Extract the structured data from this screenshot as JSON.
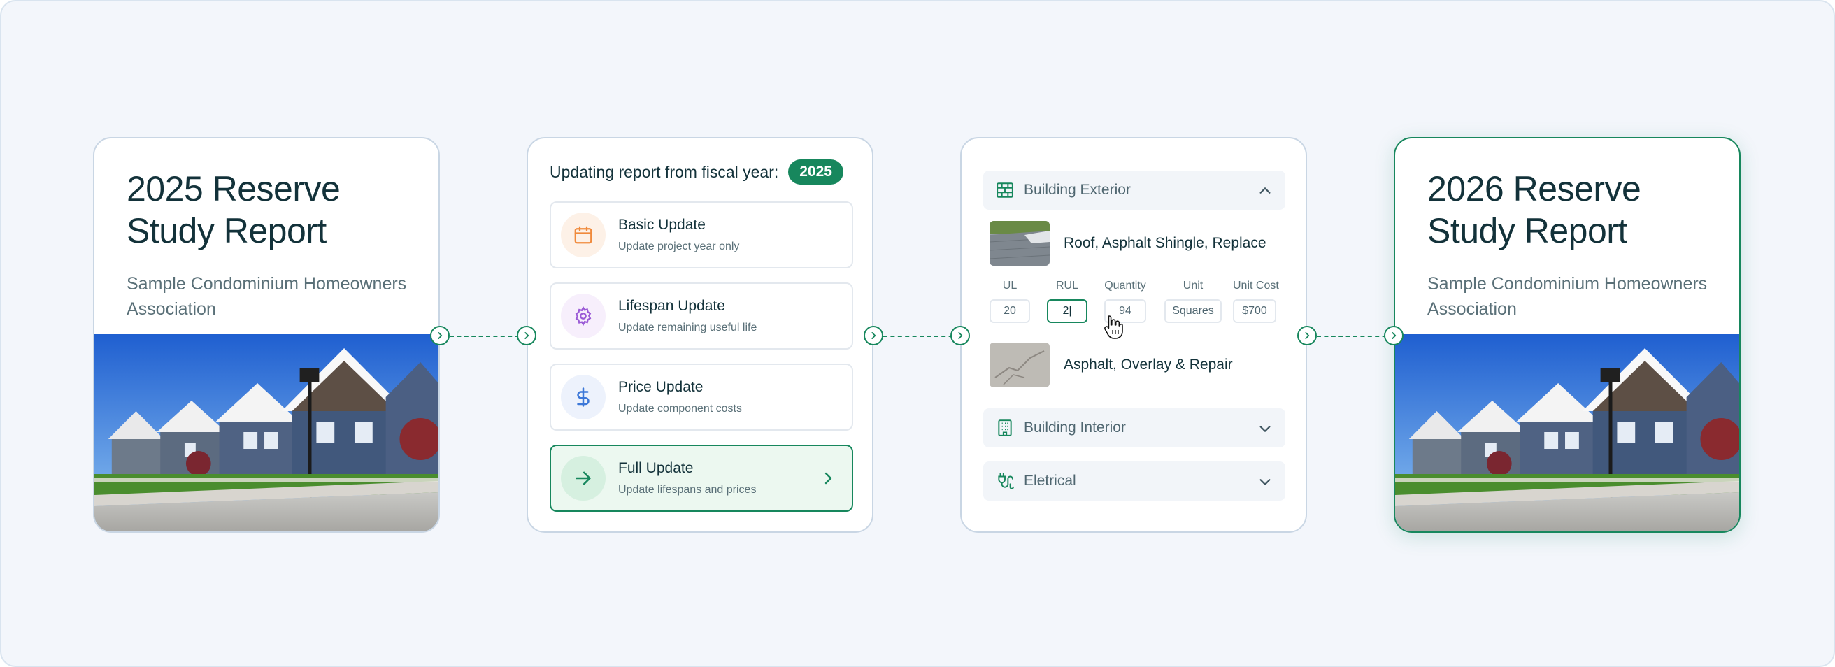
{
  "colors": {
    "accent": "#17875d",
    "text": "#13323a",
    "muted": "#5a7078"
  },
  "report_before": {
    "title": "2025 Reserve Study Report",
    "subtitle": "Sample Condominium Homeowners Association",
    "image_icon": "townhouse-photo"
  },
  "fiscal": {
    "label": "Updating report from fiscal year:",
    "year": "2025",
    "options": [
      {
        "title": "Basic Update",
        "desc": "Update project year only",
        "icon": "calendar-icon"
      },
      {
        "title": "Lifespan Update",
        "desc": "Update remaining useful life",
        "icon": "gear-icon"
      },
      {
        "title": "Price Update",
        "desc": "Update component costs",
        "icon": "dollar-icon"
      },
      {
        "title": "Full Update",
        "desc": "Update lifespans and prices",
        "icon": "arrow-right-icon",
        "selected": true
      }
    ]
  },
  "components": {
    "sections": [
      {
        "label": "Building Exterior",
        "icon": "brick-wall-icon",
        "expanded": true
      },
      {
        "label": "Building Interior",
        "icon": "building-icon",
        "expanded": false
      },
      {
        "label": "Eletrical",
        "icon": "plug-icon",
        "expanded": false
      }
    ],
    "items": [
      {
        "name": "Roof, Asphalt Shingle, Replace"
      },
      {
        "name": "Asphalt, Overlay & Repair"
      }
    ],
    "fields": [
      {
        "label": "UL",
        "value": "20"
      },
      {
        "label": "RUL",
        "value": "2|"
      },
      {
        "label": "Quantity",
        "value": "94"
      },
      {
        "label": "Unit",
        "value": "Squares"
      },
      {
        "label": "Unit Cost",
        "value": "$700"
      }
    ]
  },
  "report_after": {
    "title": "2026 Reserve Study Report",
    "subtitle": "Sample Condominium Homeowners Association",
    "image_icon": "townhouse-photo"
  }
}
